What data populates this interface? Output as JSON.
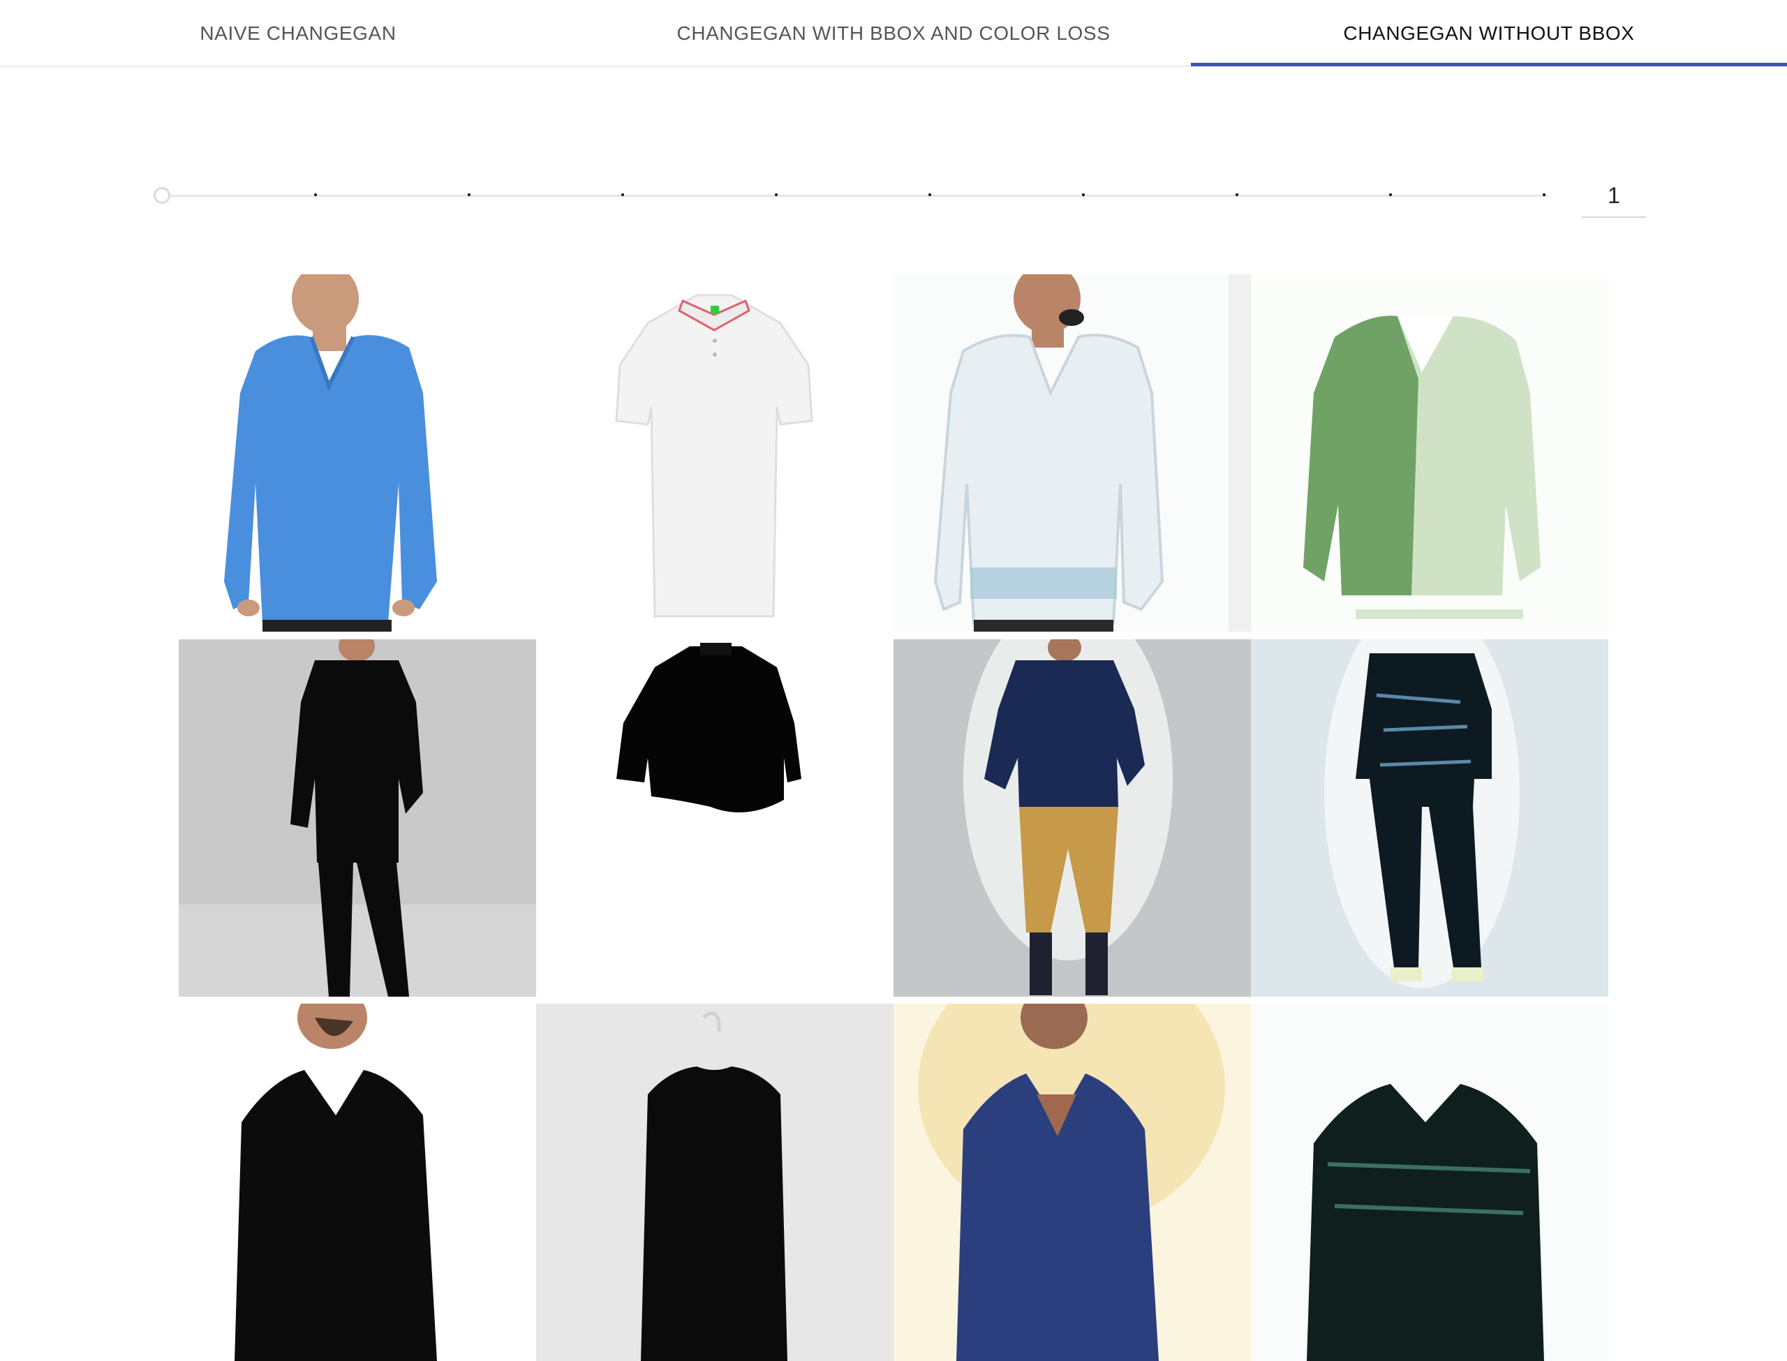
{
  "tabs": [
    {
      "label": "NAIVE CHANGEGAN",
      "active": false
    },
    {
      "label": "CHANGEGAN WITH BBOX AND COLOR LOSS",
      "active": false
    },
    {
      "label": "CHANGEGAN WITHOUT BBOX",
      "active": true
    }
  ],
  "slider": {
    "value": "1",
    "tick_count": 9
  },
  "colors": {
    "accent": "#3f51b5"
  },
  "images": {
    "rows": [
      [
        "model-blue-vneck-longsleeve",
        "white-polo-shirt",
        "generated-white-vneck-model",
        "generated-green-sweater"
      ],
      [
        "model-black-top-black-pants",
        "black-longsleeve-top",
        "generated-navy-top-tan-pants",
        "generated-dark-outfit-model"
      ],
      [
        "model-black-vneck",
        "black-shirt-on-hanger",
        "generated-blue-vneck-model",
        "generated-dark-sweater"
      ]
    ]
  }
}
